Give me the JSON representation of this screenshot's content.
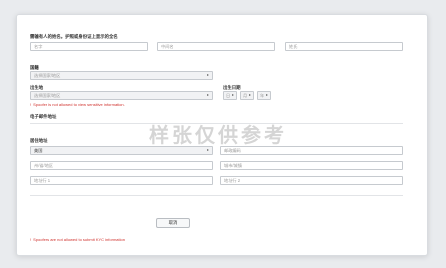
{
  "form": {
    "name_heading": "需输有人的姓名。护照或身份证上显示的全名",
    "first_name_placeholder": "名字",
    "middle_name_placeholder": "中间名",
    "last_name_placeholder": "姓氏",
    "nationality_label": "国籍",
    "nationality_placeholder": "选择国家/地区",
    "birthplace_label": "出生地",
    "birthplace_placeholder": "选择国家/地区",
    "dob_label": "出生日期",
    "dob_day": "日",
    "dob_month": "月",
    "dob_year": "年",
    "birthplace_error": "Spoofer is not allowed to view sensitive information.",
    "email_label": "电子邮件地址",
    "residence_label": "居住地址",
    "residence_country": "美国",
    "postal_code_placeholder": "邮政编码",
    "state_placeholder": "州/省/地区",
    "city_placeholder": "城市/城镇",
    "address1_placeholder": "地址行 1",
    "address2_placeholder": "地址行 2",
    "cancel_label": "取消",
    "submit_error": "Spoofers are not allowed to submit KYC information"
  },
  "watermark": "样张仅供参考",
  "colors": {
    "error": "#d0312d",
    "background": "#e9ebee",
    "card": "#ffffff"
  }
}
